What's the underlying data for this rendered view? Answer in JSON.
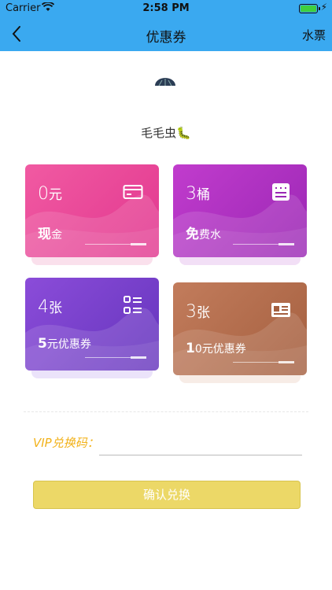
{
  "status_bar": {
    "carrier": "Carrier",
    "time": "2:58 PM",
    "icons": [
      "wifi-icon",
      "battery-icon",
      "charging-bolt-icon"
    ]
  },
  "nav": {
    "title": "优惠券",
    "right_action": "水票",
    "back_icon": "chevron-left-icon"
  },
  "user": {
    "name": "毛毛虫🐛",
    "avatar": "avatar"
  },
  "cards": [
    {
      "amount": "0",
      "unit": "元",
      "label_bold": "现",
      "label_rest": "金",
      "icon": "card-icon",
      "colors": [
        "#f05aa0",
        "#e0358f"
      ]
    },
    {
      "amount": "3",
      "unit": "桶",
      "label_bold": "免",
      "label_rest": "费水",
      "icon": "ticket-icon",
      "colors": [
        "#bf39cc",
        "#9a25b4"
      ]
    },
    {
      "amount": "4",
      "unit": "张",
      "label_bold": "5",
      "label_rest": "元优惠券",
      "icon": "list-icon",
      "colors": [
        "#8a4bd8",
        "#6634bd"
      ]
    },
    {
      "amount": "3",
      "unit": "张",
      "label_bold": "1",
      "label_rest": "0元优惠券",
      "icon": "id-card-icon",
      "colors": [
        "#c07a5a",
        "#a45f3e"
      ]
    }
  ],
  "vip": {
    "label": "VIP兑换码：",
    "value": "",
    "button": "确认兑换"
  }
}
